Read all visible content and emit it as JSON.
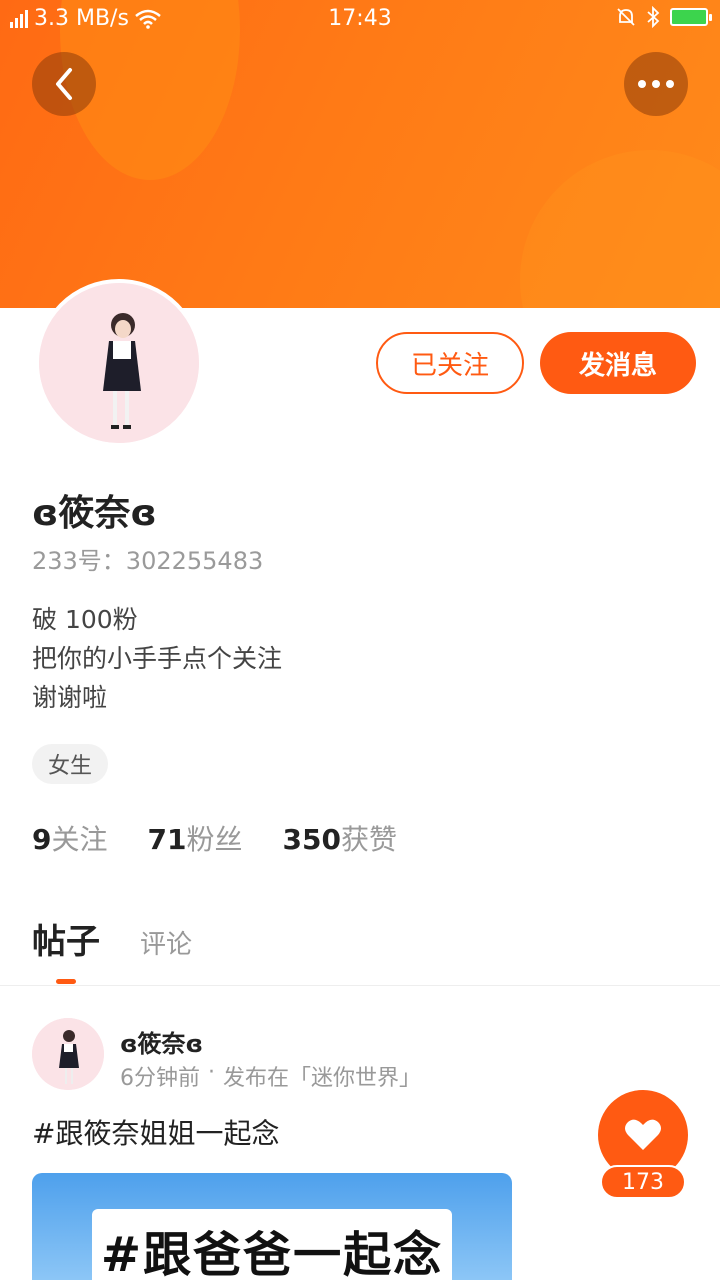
{
  "status_bar": {
    "network_speed": "3.3 MB/s",
    "time": "17:43"
  },
  "header": {
    "back_icon": "chevron-left-icon",
    "more_icon": "more-dots-icon"
  },
  "profile": {
    "username": "ɞ筱奈ɞ",
    "id_label": "233号：302255483",
    "bio_lines": [
      "破 100粉",
      "把你的小手手点个关注",
      "谢谢啦"
    ],
    "tag": "女生",
    "followed_label": "已关注",
    "message_label": "发消息"
  },
  "stats": [
    {
      "num": "9",
      "label": "关注"
    },
    {
      "num": "71",
      "label": "粉丝"
    },
    {
      "num": "350",
      "label": "获赞"
    }
  ],
  "tabs": [
    {
      "label": "帖子",
      "active": true
    },
    {
      "label": "评论",
      "active": false
    }
  ],
  "post": {
    "author": "ɞ筱奈ɞ",
    "time": "6分钟前",
    "separator": "·",
    "location": "发布在「迷你世界」",
    "text": "#跟筱奈姐姐一起念",
    "image_caption": "#跟爸爸一起念",
    "likes": "173"
  },
  "colors": {
    "accent": "#ff5a12",
    "banner": "#ff7a16"
  }
}
